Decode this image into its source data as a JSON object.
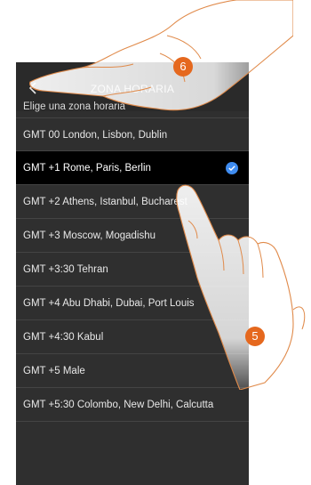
{
  "header": {
    "title": "ZONA HORARIA",
    "back_icon": "chevron-left-icon"
  },
  "subtitle": "Elige una zona horaria",
  "timezones": [
    {
      "label": "GMT 00 London, Lisbon, Dublin",
      "selected": false
    },
    {
      "label": "GMT +1 Rome, Paris, Berlin",
      "selected": true
    },
    {
      "label": "GMT +2 Athens, Istanbul, Bucharest",
      "selected": false
    },
    {
      "label": "GMT +3 Moscow, Mogadishu",
      "selected": false
    },
    {
      "label": "GMT +3:30 Tehran",
      "selected": false
    },
    {
      "label": "GMT +4 Abu Dhabi, Dubai, Port Louis",
      "selected": false
    },
    {
      "label": "GMT +4:30 Kabul",
      "selected": false
    },
    {
      "label": "GMT +5 Male",
      "selected": false
    },
    {
      "label": "GMT +5:30 Colombo, New Delhi, Calcutta",
      "selected": false
    }
  ],
  "steps": {
    "back_step": "6",
    "select_step": "5"
  },
  "colors": {
    "screen_bg": "#2f2f2f",
    "selected_row_bg": "#000000",
    "check_accent": "#3f8cf0",
    "step_badge": "#e5681e"
  }
}
